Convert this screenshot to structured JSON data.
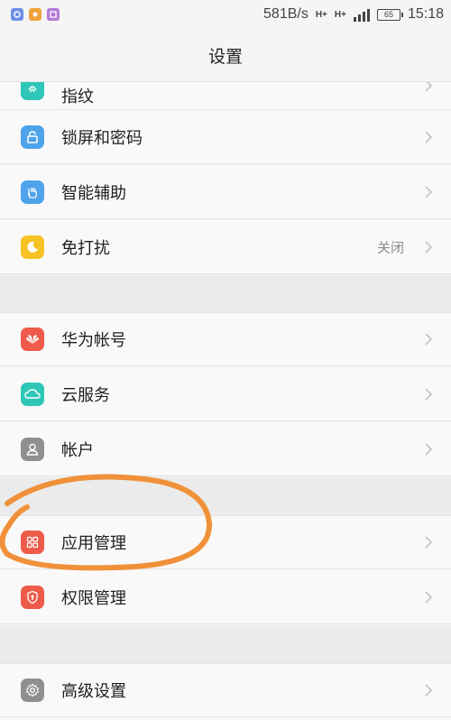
{
  "status_bar": {
    "speed": "581B/s",
    "network_1": "H+",
    "network_2": "H+",
    "battery": "65",
    "time": "15:18"
  },
  "title": "设置",
  "rows": {
    "fingerprint": {
      "label": "指纹",
      "icon": "fingerprint-icon",
      "color": "#2ec6b6"
    },
    "lockscreen": {
      "label": "锁屏和密码",
      "icon": "lock-icon",
      "color": "#4ea3ea"
    },
    "assist": {
      "label": "智能辅助",
      "icon": "hand-icon",
      "color": "#4ea3ea"
    },
    "dnd": {
      "label": "免打扰",
      "value": "关闭",
      "icon": "moon-icon",
      "color": "#f6c224"
    },
    "huawei_id": {
      "label": "华为帐号",
      "icon": "huawei-icon",
      "color": "#ee5b4a"
    },
    "cloud": {
      "label": "云服务",
      "icon": "cloud-icon",
      "color": "#2ec6b6"
    },
    "accounts": {
      "label": "帐户",
      "icon": "person-icon",
      "color": "#8f8f8f"
    },
    "apps": {
      "label": "应用管理",
      "icon": "apps-grid-icon",
      "color": "#ee5b4a"
    },
    "permissions": {
      "label": "权限管理",
      "icon": "shield-icon",
      "color": "#ee5b4a"
    },
    "advanced": {
      "label": "高级设置",
      "icon": "gear-icon",
      "color": "#8f8f8f"
    }
  },
  "annotation_color": "#f0913a"
}
